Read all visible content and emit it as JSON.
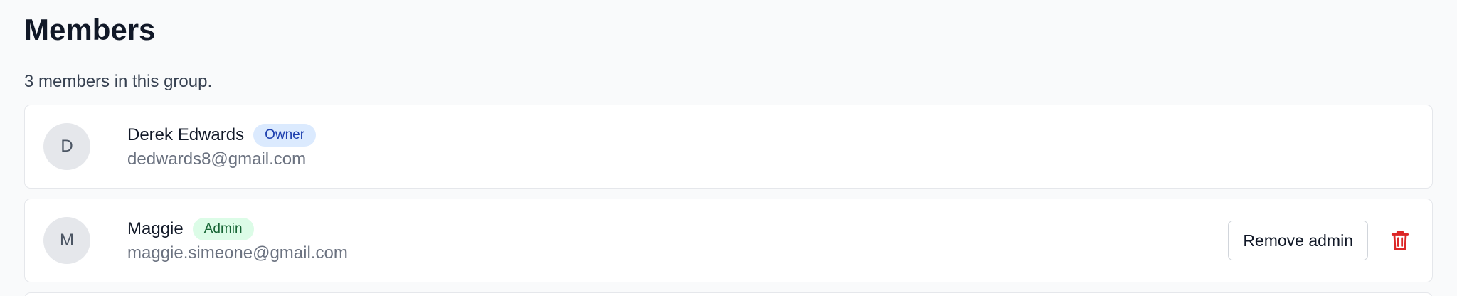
{
  "header": {
    "title": "Members",
    "subtitle": "3 members in this group."
  },
  "colors": {
    "owner_badge_bg": "#dbeafe",
    "owner_badge_text": "#1e40af",
    "admin_badge_bg": "#dcfce7",
    "admin_badge_text": "#166534",
    "delete_icon": "#dc2626"
  },
  "members": [
    {
      "initial": "D",
      "name": "Derek Edwards",
      "role": "Owner",
      "email": "dedwards8@gmail.com"
    },
    {
      "initial": "M",
      "name": "Maggie",
      "role": "Admin",
      "email": "maggie.simeone@gmail.com",
      "action_label": "Remove admin",
      "delete_icon": "trash-icon"
    }
  ]
}
